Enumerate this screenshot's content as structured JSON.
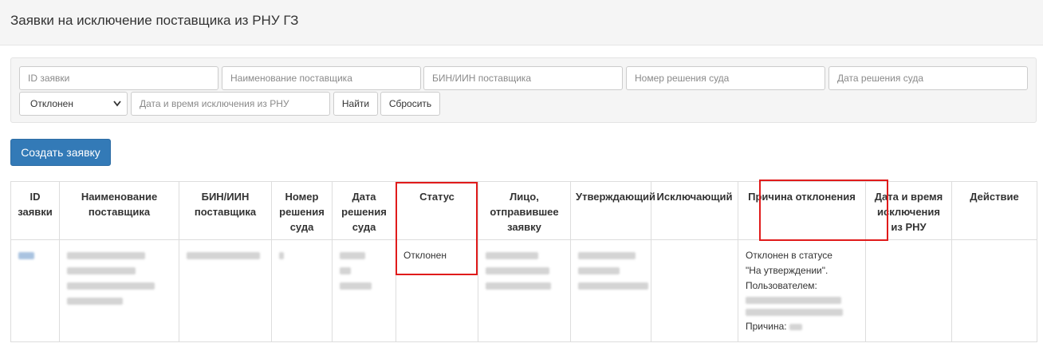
{
  "header": {
    "title": "Заявки на исключение поставщика из РНУ ГЗ"
  },
  "filters": {
    "request_id_placeholder": "ID заявки",
    "supplier_name_placeholder": "Наименование поставщика",
    "bin_placeholder": "БИН/ИИН поставщика",
    "court_decision_number_placeholder": "Номер решения суда",
    "court_decision_date_placeholder": "Дата решения суда",
    "status_selected": "Отклонен",
    "exclusion_datetime_placeholder": "Дата и время исключения из РНУ",
    "find_label": "Найти",
    "reset_label": "Сбросить"
  },
  "actions": {
    "create_label": "Создать заявку"
  },
  "table": {
    "columns": [
      "ID заявки",
      "Наименование поставщика",
      "БИН/ИИН поставщика",
      "Номер решения суда",
      "Дата решения суда",
      "Статус",
      "Лицо, отправившее заявку",
      "Утверждающий",
      "Исключающий",
      "Причина отклонения",
      "Дата и время исключения из РНУ",
      "Действие"
    ],
    "rows": [
      {
        "status": "Отклонен",
        "reason_line1": "Отклонен в статусе",
        "reason_line2": "\"На утверждении\".",
        "reason_line3": "Пользователем:",
        "reason_label": "Причина:"
      }
    ]
  },
  "colors": {
    "primary": "#337ab7",
    "highlight": "#e01b1b"
  },
  "icons": {
    "select_chevron": "chevron-down-icon"
  }
}
